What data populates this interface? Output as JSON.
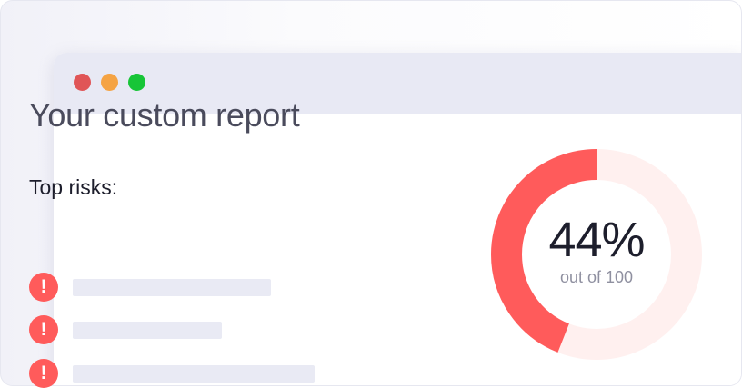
{
  "report": {
    "title": "Your custom report",
    "risks_heading": "Top risks:",
    "risk_icon_glyph": "!",
    "risk_items": [
      {
        "icon": "exclamation-icon"
      },
      {
        "icon": "exclamation-icon"
      },
      {
        "icon": "exclamation-icon"
      }
    ]
  },
  "score": {
    "percent_text": "44%",
    "caption": "out of 100",
    "value": 44,
    "max": 100
  },
  "colors": {
    "dot_red": "#e05557",
    "dot_yellow": "#f5a343",
    "dot_green": "#17c537",
    "accent": "#ff5b5b",
    "ring_track": "#fff0ef"
  }
}
